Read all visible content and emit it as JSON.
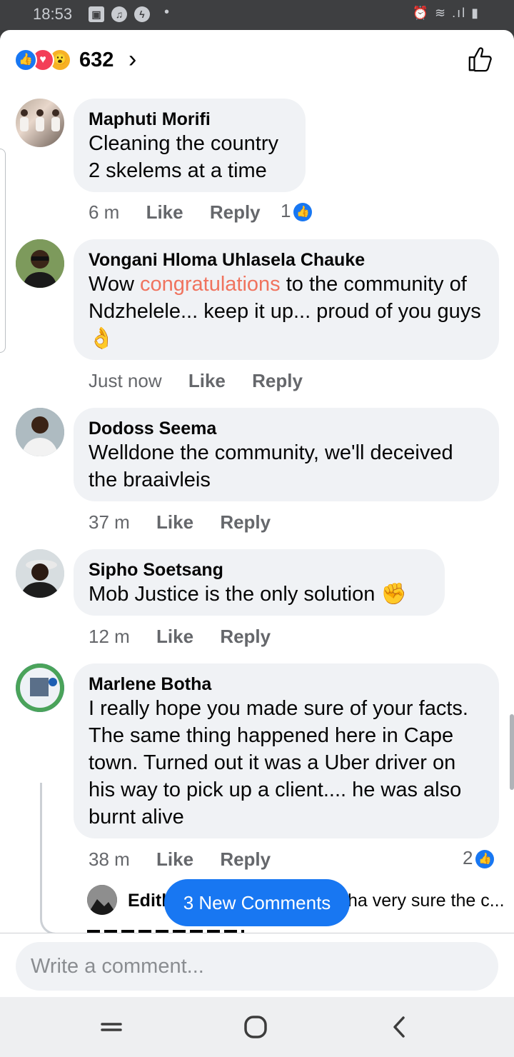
{
  "status": {
    "time": "18:53"
  },
  "reactions": {
    "count": "632"
  },
  "comments": [
    {
      "name": "Maphuti Morifi",
      "text_lines": [
        "Cleaning the country",
        "2 skelems at a time"
      ],
      "time": "6 m",
      "like": "Like",
      "reply": "Reply",
      "reaction_count": "1"
    },
    {
      "name": "Vongani Hloma Uhlasela Chauke",
      "text_parts": [
        "Wow ",
        "congratulations",
        " to the community of Ndzhelele... keep it up... proud of you guys",
        "👌"
      ],
      "time": "Just now",
      "like": "Like",
      "reply": "Reply"
    },
    {
      "name": "Dodoss Seema",
      "text": "Welldone the community, we'll deceived the braaivleis",
      "time": "37 m",
      "like": "Like",
      "reply": "Reply"
    },
    {
      "name": "Sipho Soetsang",
      "text": "Mob Justice is the only solution ",
      "emoji": "✊",
      "time": "12 m",
      "like": "Like",
      "reply": "Reply"
    },
    {
      "name": "Marlene Botha",
      "text": "I really hope you made sure of your facts. The same thing happened here in Cape town. Turned out it was a Uber driver on his way to pick up a client.... he was also burnt alive",
      "time": "38 m",
      "like": "Like",
      "reply": "Reply",
      "reaction_count": "2",
      "reply_preview": {
        "name": "Editl",
        "snippet": "ha very sure the c..."
      }
    }
  ],
  "new_comments_label": "3 New Comments",
  "composer": {
    "placeholder": "Write a comment..."
  },
  "colors": {
    "accent": "#1877f2",
    "bubble": "#f0f2f5",
    "highlight": "#f0735e"
  }
}
